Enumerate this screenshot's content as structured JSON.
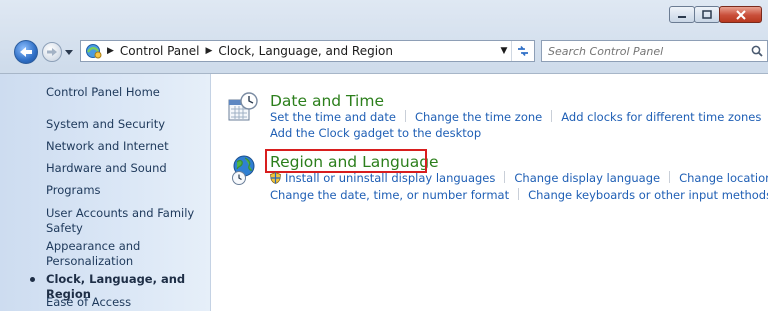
{
  "address": {
    "breadcrumbs": [
      "Control Panel",
      "Clock, Language, and Region"
    ]
  },
  "search": {
    "placeholder": "Search Control Panel"
  },
  "sidebar": {
    "items": [
      {
        "label": "Control Panel Home"
      },
      {
        "label": "System and Security"
      },
      {
        "label": "Network and Internet"
      },
      {
        "label": "Hardware and Sound"
      },
      {
        "label": "Programs"
      },
      {
        "label": "User Accounts and Family",
        "label2": "Safety"
      },
      {
        "label": "Appearance and",
        "label2": "Personalization"
      },
      {
        "label": "Clock, Language, and Region",
        "current": true
      },
      {
        "label": "Ease of Access"
      }
    ]
  },
  "categories": [
    {
      "title": "Date and Time",
      "links_row1": [
        "Set the time and date",
        "Change the time zone",
        "Add clocks for different time zones"
      ],
      "links_row2": [
        "Add the Clock gadget to the desktop"
      ]
    },
    {
      "title": "Region and Language",
      "highlighted": true,
      "links_row1": [
        "Install or uninstall display languages",
        "Change display language",
        "Change location"
      ],
      "links_row2": [
        "Change the date, time, or number format",
        "Change keyboards or other input methods"
      ]
    }
  ],
  "colors": {
    "link": "#1f5fb5",
    "category_title": "#2c7f1c",
    "highlight_box": "#d81e1e",
    "sidebar_bg": "#dbe7f6"
  }
}
